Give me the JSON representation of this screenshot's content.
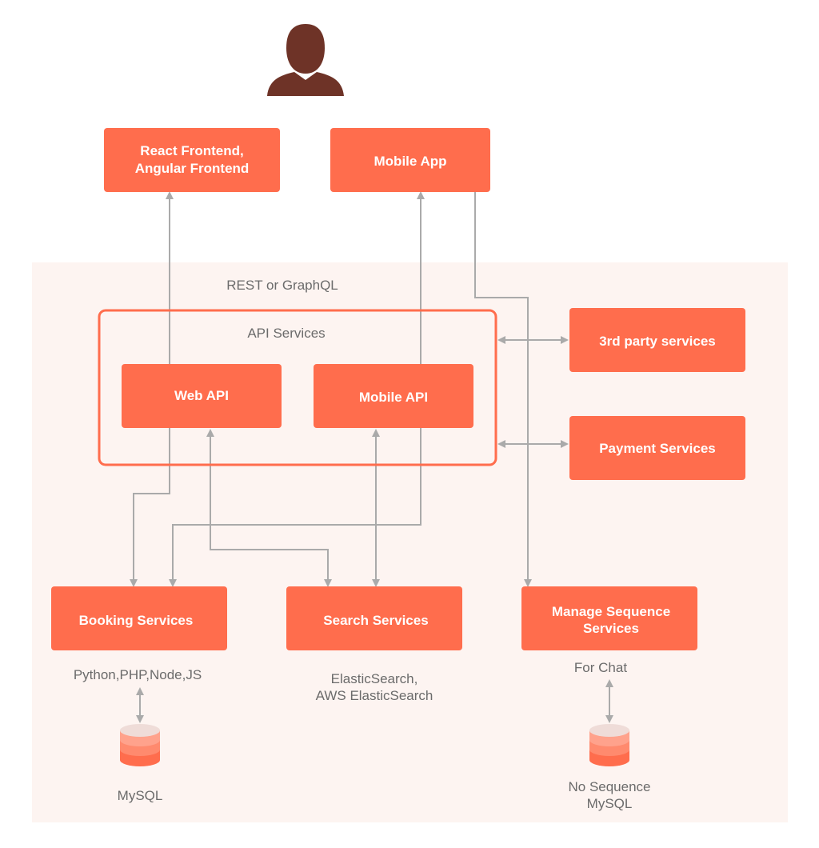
{
  "colors": {
    "box": "#ff6d4d",
    "panel": "#fdf4f1",
    "connector": "#aaaaaa",
    "user": "#6e3327"
  },
  "user": {
    "icon": "user-icon"
  },
  "clients": {
    "web": [
      "React Frontend,",
      "Angular Frontend"
    ],
    "mobile": "Mobile App"
  },
  "backend": {
    "protocol_label": "REST or GraphQL",
    "api_group_label": "API Services",
    "web_api": "Web API",
    "mobile_api": "Mobile API",
    "third_party": "3rd party services",
    "payment": "Payment Services",
    "booking": "Booking Services",
    "search": "Search Services",
    "manage": [
      "Manage Sequence",
      "Services"
    ],
    "booking_tech": "Python,PHP,Node,JS",
    "booking_db": "MySQL",
    "search_tech": [
      "ElasticSearch,",
      "AWS ElasticSearch"
    ],
    "manage_note": "For Chat",
    "manage_db": [
      "No Sequence",
      "MySQL"
    ]
  }
}
